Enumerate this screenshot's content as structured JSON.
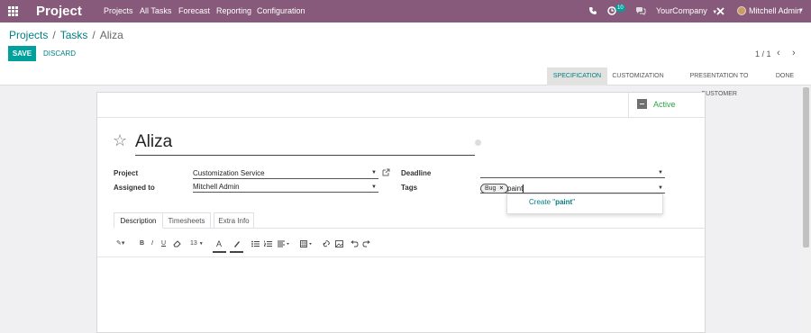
{
  "navbar": {
    "brand": "Project",
    "menu": [
      "Projects",
      "All Tasks",
      "Forecast",
      "Reporting",
      "Configuration"
    ],
    "activity_count": "10",
    "company": "YourCompany",
    "user": "Mitchell Admin",
    "color": "#875a7b"
  },
  "breadcrumb": {
    "projects": "Projects",
    "tasks": "Tasks",
    "current": "Aliza",
    "sep": "/"
  },
  "buttons": {
    "save": "SAVE",
    "discard": "DISCARD"
  },
  "pager": {
    "value": "1 / 1",
    "prev": "‹",
    "next": "›"
  },
  "stages": [
    "SPECIFICATION",
    "CUSTOMIZATION",
    "PRESENTATION TO CUSTOMER",
    "DONE"
  ],
  "active_stage": "SPECIFICATION",
  "status": {
    "active": "Active"
  },
  "task": {
    "name": "Aliza"
  },
  "fields": {
    "project_label": "Project",
    "project_value": "Customization Service",
    "assigned_label": "Assigned to",
    "assigned_value": "Mitchell Admin",
    "deadline_label": "Deadline",
    "deadline_value": "",
    "tags_label": "Tags",
    "tag_chip": "Bug",
    "tag_input": "paint"
  },
  "dropdown": {
    "create_prefix": "Create \"",
    "create_term": "paint",
    "create_suffix": "\""
  },
  "tabs": [
    "Description",
    "Timesheets",
    "Extra Info"
  ],
  "toolbar": {
    "font_size": "13",
    "text_color": "A",
    "bold": "B",
    "italic": "I",
    "underline": "U"
  },
  "colors": {
    "accent": "#00a09d",
    "link": "#017e84",
    "active": "#28a745"
  }
}
